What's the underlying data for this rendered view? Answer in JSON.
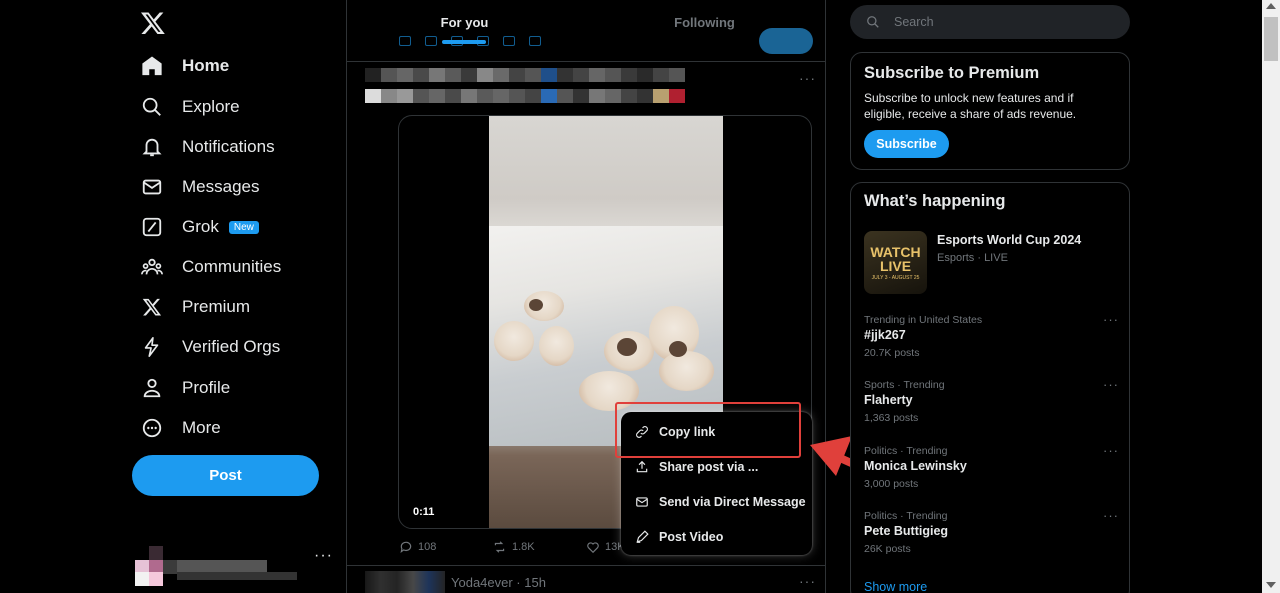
{
  "nav": {
    "items": [
      {
        "label": "Home",
        "icon": "home-icon"
      },
      {
        "label": "Explore",
        "icon": "search-icon"
      },
      {
        "label": "Notifications",
        "icon": "bell-icon"
      },
      {
        "label": "Messages",
        "icon": "envelope-icon"
      },
      {
        "label": "Grok",
        "icon": "grok-icon",
        "badge": "New"
      },
      {
        "label": "Communities",
        "icon": "people-icon"
      },
      {
        "label": "Premium",
        "icon": "x-logo-icon"
      },
      {
        "label": "Verified Orgs",
        "icon": "lightning-icon"
      },
      {
        "label": "Profile",
        "icon": "person-icon"
      },
      {
        "label": "More",
        "icon": "more-circle-icon"
      }
    ],
    "post_label": "Post",
    "account_more": "···"
  },
  "timeline": {
    "tabs": [
      {
        "label": "For you"
      },
      {
        "label": "Following"
      }
    ],
    "tweet": {
      "more": "···",
      "video_time": "0:11",
      "replies": "108",
      "reposts": "1.8K",
      "likes": "13K"
    },
    "next_tweet": {
      "handle": "Yoda4ever · 15h",
      "more": "···"
    }
  },
  "menu": {
    "items": [
      {
        "label": "Copy link",
        "icon": "link-icon"
      },
      {
        "label": "Share post via ...",
        "icon": "share-icon"
      },
      {
        "label": "Send via Direct Message",
        "icon": "envelope-icon"
      },
      {
        "label": "Post Video",
        "icon": "pencil-icon"
      }
    ]
  },
  "sidebar": {
    "search_placeholder": "Search",
    "premium": {
      "title": "Subscribe to Premium",
      "desc": "Subscribe to unlock new features and if eligible, receive a share of ads revenue.",
      "button": "Subscribe"
    },
    "happening": {
      "title": "What’s happening",
      "event": {
        "title": "Esports World Cup 2024",
        "sub": "Esports · LIVE",
        "thumb_line1": "WATCH",
        "thumb_line2": "LIVE",
        "thumb_dates": "JULY 3 - AUGUST 25"
      },
      "trends": [
        {
          "context": "Trending in United States",
          "name": "#jjk267",
          "count": "20.7K posts"
        },
        {
          "context": "Sports · Trending",
          "name": "Flaherty",
          "count": "1,363 posts"
        },
        {
          "context": "Politics · Trending",
          "name": "Monica Lewinsky",
          "count": "3,000 posts"
        },
        {
          "context": "Politics · Trending",
          "name": "Pete Buttigieg",
          "count": "26K posts"
        }
      ],
      "trend_more": "···",
      "show_more": "Show more"
    }
  },
  "colors": {
    "accent": "#1d9bf0",
    "highlight": "#e0403b",
    "background": "#000000"
  }
}
